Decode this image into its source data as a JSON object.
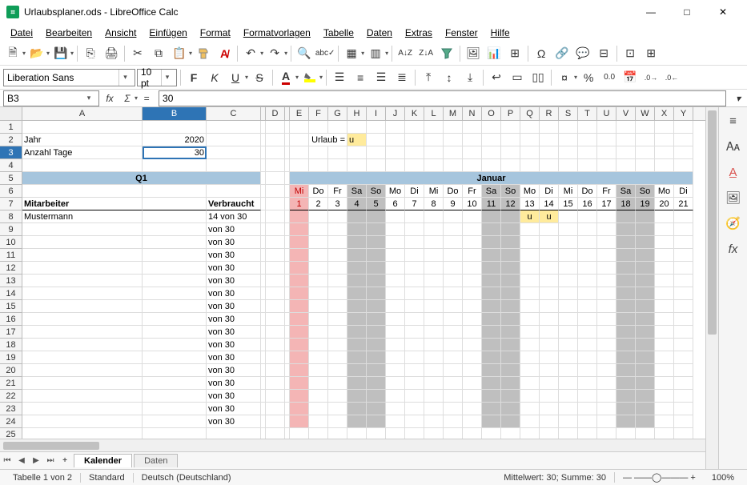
{
  "window": {
    "title": "Urlaubsplaner.ods - LibreOffice Calc"
  },
  "menu": {
    "items": [
      "Datei",
      "Bearbeiten",
      "Ansicht",
      "Einfügen",
      "Format",
      "Formatvorlagen",
      "Tabelle",
      "Daten",
      "Extras",
      "Fenster",
      "Hilfe"
    ]
  },
  "font": {
    "name": "Liberation Sans",
    "size": "10 pt"
  },
  "cellref": "B3",
  "formula": "30",
  "columns": [
    {
      "l": "A",
      "w": 150
    },
    {
      "l": "B",
      "w": 80,
      "sel": true
    },
    {
      "l": "C",
      "w": 68
    },
    {
      "l": "",
      "w": 6
    },
    {
      "l": "D",
      "w": 24
    },
    {
      "l": "",
      "w": 6
    },
    {
      "l": "E",
      "w": 24
    },
    {
      "l": "F",
      "w": 24
    },
    {
      "l": "G",
      "w": 24
    },
    {
      "l": "H",
      "w": 24
    },
    {
      "l": "I",
      "w": 24
    },
    {
      "l": "J",
      "w": 24
    },
    {
      "l": "K",
      "w": 24
    },
    {
      "l": "L",
      "w": 24
    },
    {
      "l": "M",
      "w": 24
    },
    {
      "l": "N",
      "w": 24
    },
    {
      "l": "O",
      "w": 24
    },
    {
      "l": "P",
      "w": 24
    },
    {
      "l": "Q",
      "w": 24
    },
    {
      "l": "R",
      "w": 24
    },
    {
      "l": "S",
      "w": 24
    },
    {
      "l": "T",
      "w": 24
    },
    {
      "l": "U",
      "w": 24
    },
    {
      "l": "V",
      "w": 24
    },
    {
      "l": "W",
      "w": 24
    },
    {
      "l": "X",
      "w": 24
    },
    {
      "l": "Y",
      "w": 24
    }
  ],
  "sheet": {
    "jahr_label": "Jahr",
    "jahr_value": "2020",
    "tage_label": "Anzahl Tage",
    "tage_value": "30",
    "urlaub_label": "Urlaub =",
    "urlaub_value": "u",
    "q1": "Q1",
    "januar": "Januar",
    "mitarbeiter": "Mitarbeiter",
    "verbraucht": "Verbraucht",
    "mustermann": "Mustermann",
    "mustermann_val": "14 von 30",
    "von30": "von 30",
    "days": [
      "Mi",
      "Do",
      "Fr",
      "Sa",
      "So",
      "Mo",
      "Di",
      "Mi",
      "Do",
      "Fr",
      "Sa",
      "So",
      "Mo",
      "Di",
      "Mi",
      "Do",
      "Fr",
      "Sa",
      "So",
      "Mo",
      "Di"
    ],
    "nums": [
      "1",
      "2",
      "3",
      "4",
      "5",
      "6",
      "7",
      "8",
      "9",
      "10",
      "11",
      "12",
      "13",
      "14",
      "15",
      "16",
      "17",
      "18",
      "19",
      "20",
      "21"
    ],
    "u": "u"
  },
  "tabs": {
    "active": "Kalender",
    "inactive": "Daten",
    "add": "+"
  },
  "status": {
    "sheet": "Tabelle 1 von 2",
    "mode": "Standard",
    "lang": "Deutsch (Deutschland)",
    "stats": "Mittelwert: 30; Summe: 30",
    "zoom": "100%",
    "slider_char": "—"
  },
  "colors": {
    "header_blue": "#a6c5dd",
    "weekend": "#bfbfbf",
    "holiday": "#f4b5b5",
    "vac": "#ffeb9c",
    "red": "#c00000"
  }
}
